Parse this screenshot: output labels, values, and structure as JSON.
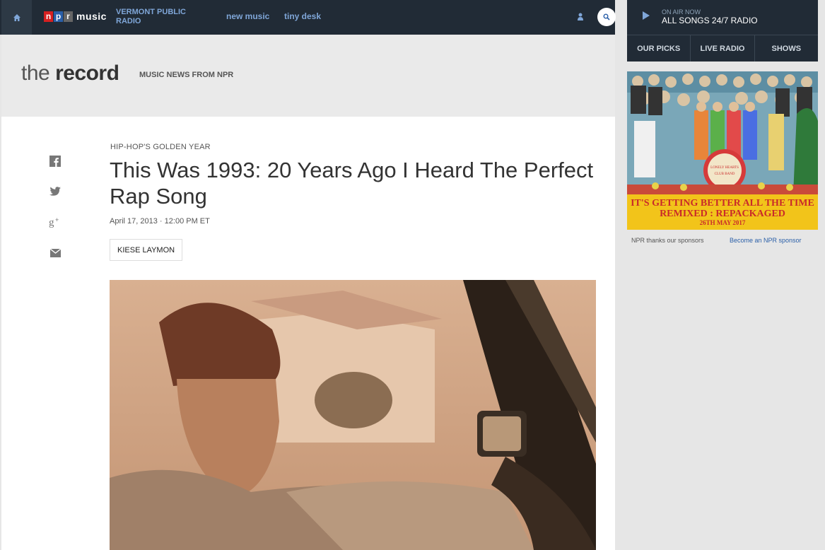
{
  "nav": {
    "logo_letters": [
      "n",
      "p",
      "r"
    ],
    "logo_music": "music",
    "station": "VERMONT PUBLIC RADIO",
    "links": [
      "new music",
      "tiny desk"
    ]
  },
  "player": {
    "label": "ON AIR NOW",
    "title": "ALL SONGS 24/7 RADIO",
    "tabs": [
      "OUR PICKS",
      "LIVE RADIO",
      "SHOWS"
    ]
  },
  "section": {
    "the": "the",
    "record": "record",
    "tagline": "MUSIC NEWS FROM NPR"
  },
  "article": {
    "slug": "HIP-HOP'S GOLDEN YEAR",
    "headline": "This Was 1993: 20 Years Ago I Heard The Perfect Rap Song",
    "date": "April 17, 2013 · 12:00 PM ET",
    "author": "KIESE LAYMON",
    "share_icons": [
      "facebook-icon",
      "twitter-icon",
      "google-plus-icon",
      "email-icon"
    ]
  },
  "ad": {
    "line1": "IT'S GETTING BETTER ALL THE TIME",
    "line2": "REMIXED : REPACKAGED",
    "line3": "26TH MAY 2017",
    "sponsor_text": "NPR thanks our sponsors",
    "sponsor_link": "Become an NPR sponsor"
  },
  "colors": {
    "nav_bg": "#212b36",
    "nav_link": "#7fa6d8",
    "sponsor_link": "#2a5fa8"
  }
}
